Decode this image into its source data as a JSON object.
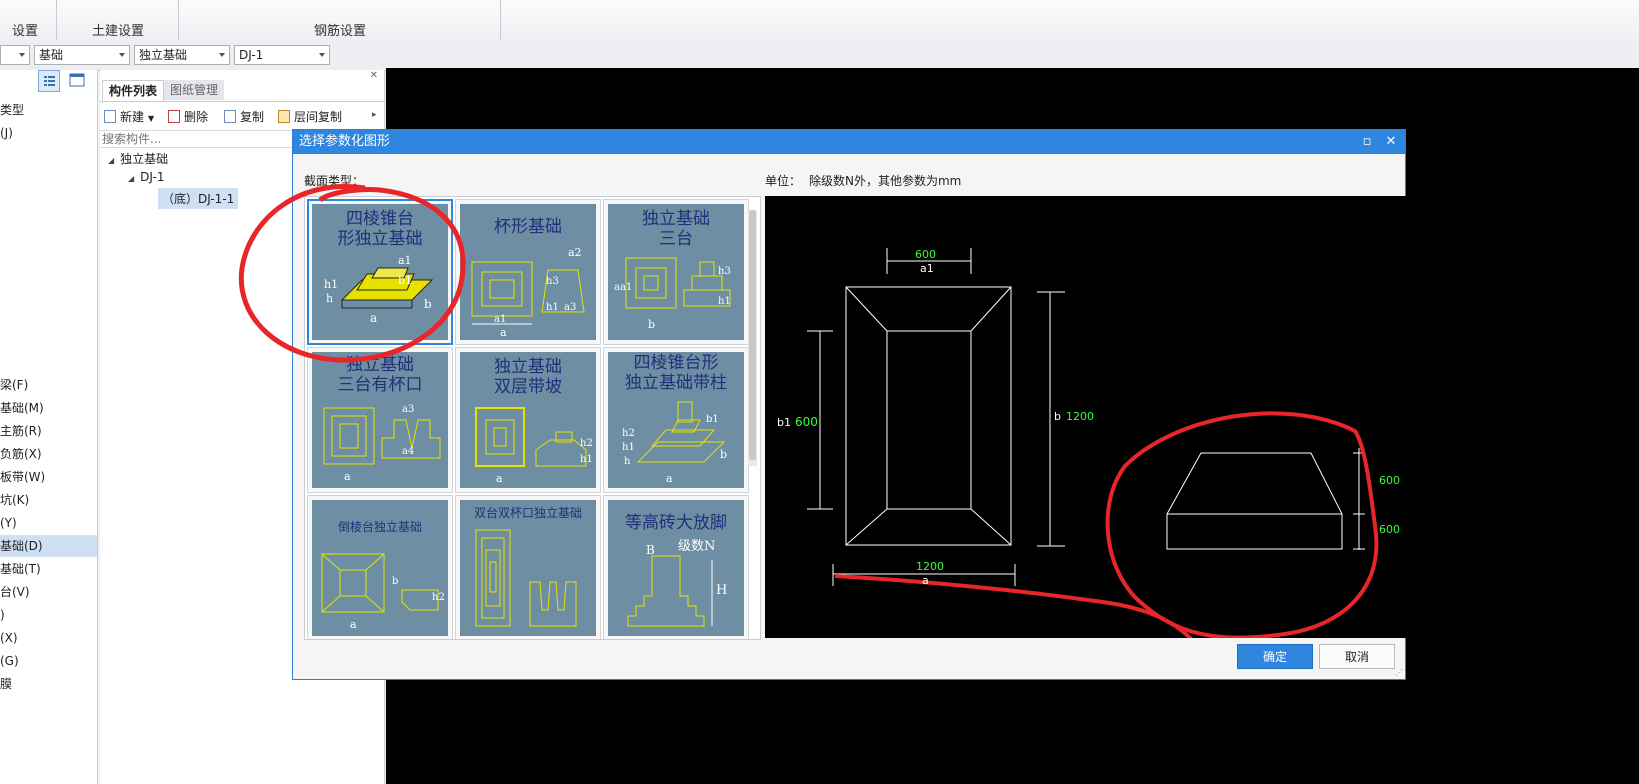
{
  "ribbon": {
    "group1": "设置",
    "group2": "土建设置",
    "group3": "钢筋设置"
  },
  "combos": {
    "c0": "",
    "c1": "基础",
    "c2": "独立基础",
    "c3": "DJ-1"
  },
  "leftnav": {
    "items": [
      "类型",
      "(J)",
      "梁(F)",
      "基础(M)",
      "主筋(R)",
      "负筋(X)",
      "板带(W)",
      "坑(K)",
      "(Y)",
      "基础(D)",
      "基础(T)",
      "台(V)",
      ")",
      "(X)",
      "(G)",
      "膜"
    ],
    "selected_index": 9
  },
  "component_panel": {
    "tab_list": "构件列表",
    "tab_drawings": "图纸管理",
    "btn_new": "新建",
    "btn_delete": "删除",
    "btn_copy": "复制",
    "btn_floor_copy": "层间复制",
    "search_placeholder": "搜索构件...",
    "tree_root": "独立基础",
    "tree_child": "DJ-1",
    "tree_leaf": "（底）DJ-1-1"
  },
  "dialog": {
    "title": "选择参数化图形",
    "section_label": "截面类型：",
    "unit_label": "单位：",
    "unit_text": "除级数N外，其他参数为mm",
    "ok": "确定",
    "cancel": "取消",
    "thumbs": [
      {
        "title": "四棱锥台形独立基础",
        "line1": "四棱锥台",
        "line2": "形独立基础"
      },
      {
        "title": "杯形基础",
        "line1": "杯形基础",
        "line2": ""
      },
      {
        "title": "独立基础三台",
        "line1": "独立基础",
        "line2": "三台"
      },
      {
        "title": "独立基础三台有杯口",
        "line1": "独立基础",
        "line2": "三台有杯口"
      },
      {
        "title": "独立基础双层带坡",
        "line1": "独立基础",
        "line2": "双层带坡"
      },
      {
        "title": "四棱锥台形独立基础带柱",
        "line1": "四棱锥台形",
        "line2": "独立基础带柱"
      },
      {
        "title": "倒棱台独立基础",
        "line1": "倒棱台独立基础",
        "line2": ""
      },
      {
        "title": "双台双杯口独立基础",
        "line1": "双台双杯口独立基础",
        "line2": ""
      },
      {
        "title": "等高砖大放脚",
        "line1": "等高砖大放脚",
        "line2": ""
      }
    ],
    "selected_thumb": 0
  },
  "preview": {
    "a1_value": "600",
    "a1_label": "a1",
    "b1_label": "b1",
    "b1_value": "600",
    "b_label": "b",
    "b_value": "1200",
    "a_value": "1200",
    "a_label": "a",
    "h1_value": "600",
    "h_value": "600"
  },
  "colors": {
    "accent": "#2f86de",
    "thumb_bg": "#6d8ea3",
    "annotation_red": "#e8262a",
    "dim_green": "#3cff3c"
  }
}
